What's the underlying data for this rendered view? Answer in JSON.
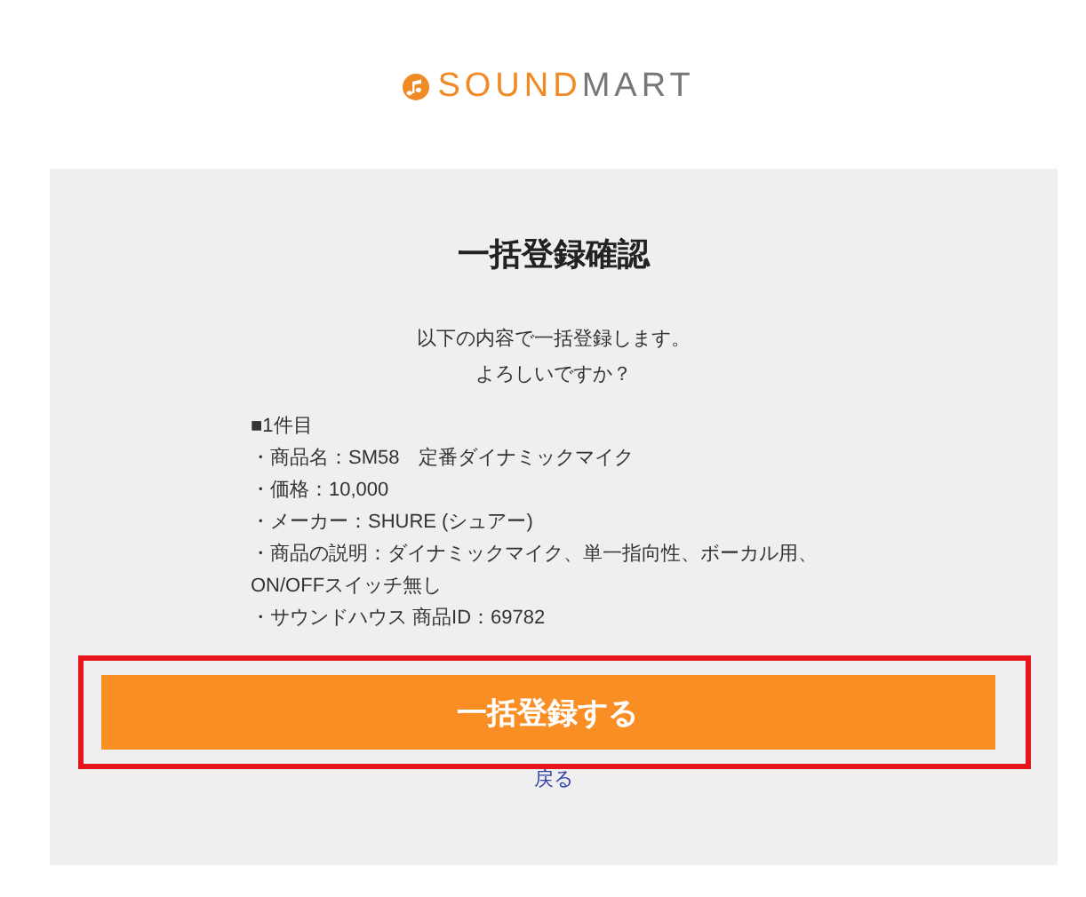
{
  "logo": {
    "accent": "SOUND",
    "rest": "MART"
  },
  "dialog": {
    "title": "一括登録確認",
    "message": [
      "以下の内容で一括登録します。",
      "よろしいですか？"
    ],
    "details": {
      "heading": "■1件目",
      "items": [
        "・商品名：SM58　定番ダイナミックマイク",
        "・価格：10,000",
        "・メーカー：SHURE (シュアー)",
        "・商品の説明：ダイナミックマイク、単一指向性、ボーカル用、ON/OFFスイッチ無し",
        "・サウンドハウス 商品ID：69782"
      ]
    },
    "submit_button": {
      "label": "一括登録する",
      "highlighted": true
    },
    "back_link": "戻る"
  }
}
